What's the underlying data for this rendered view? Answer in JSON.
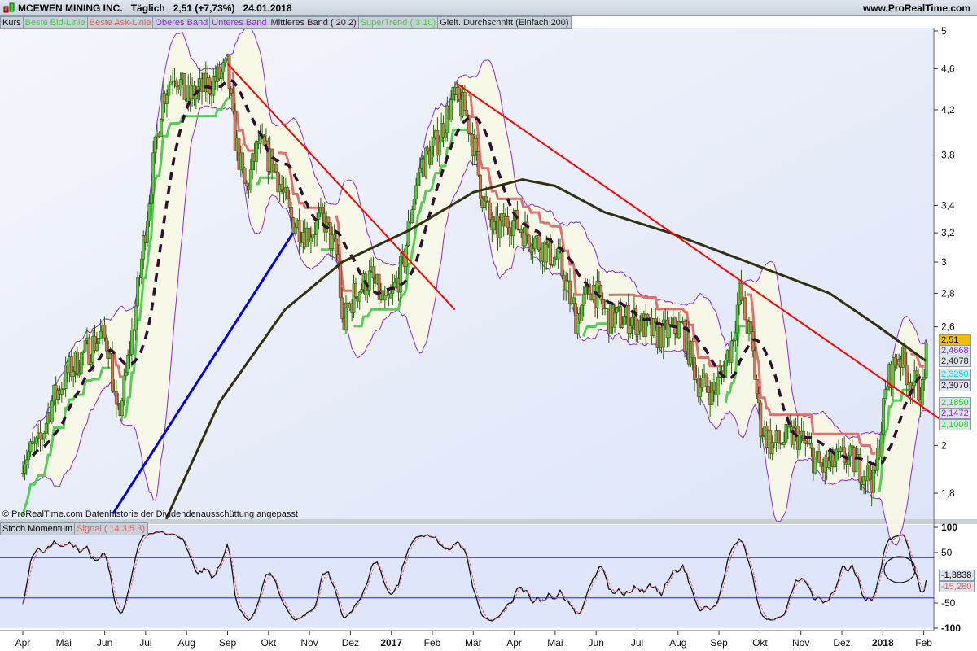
{
  "header": {
    "title": "MCEWEN MINING INC.",
    "period": "Täglich",
    "price": "2,51 (+7,73%)",
    "date": "24.01.2018",
    "url": "www.ProRealTime.com"
  },
  "legend": [
    "Kurs",
    "Beste Bid-Linie",
    "Beste Ask-Linie",
    "Oberes Band",
    "Unteres Band",
    "Mittleres Band ( 20 2)",
    "SuperTrend ( 3 10)",
    "Gleit. Durchschnitt (Einfach 200)"
  ],
  "legend_colors": [
    "#111111",
    "#44cc44",
    "#e06060",
    "#8a2be2",
    "#8a2be2",
    "#301030",
    "#44cc44",
    "#222222"
  ],
  "copyright": "© ProRealTime.com  Datenhistorie der Dividendenausschüttung angepasst",
  "lower_legend": [
    "Stoch Momentum",
    "Signal ( 14 3 5 3)"
  ],
  "value_boxes": [
    {
      "v": "2,51",
      "c": "#f0c000",
      "fg": "#000"
    },
    {
      "v": "2,4668",
      "c": "#dde4ea",
      "fg": "#8a2be2"
    },
    {
      "v": "2,4078",
      "c": "#dde4ea",
      "fg": "#222"
    },
    {
      "v": "2,3250",
      "c": "#dde4ea",
      "fg": "#00e0f0"
    },
    {
      "v": "2,3070",
      "c": "#dde4ea",
      "fg": "#301030"
    },
    {
      "v": "2,1850",
      "c": "#dde4ea",
      "fg": "#22cc22"
    },
    {
      "v": "2,1472",
      "c": "#dde4ea",
      "fg": "#8a2be2"
    },
    {
      "v": "2,1008",
      "c": "#dde4ea",
      "fg": "#44cc44"
    }
  ],
  "lower_boxes": [
    {
      "v": "-1,3838",
      "fg": "#000"
    },
    {
      "v": "-15,280",
      "fg": "#e06060"
    }
  ],
  "chart_data": {
    "type": "candlestick",
    "yscale": "log",
    "ylim": [
      1.65,
      5.05
    ],
    "yticks": [
      5,
      4.6,
      4.2,
      3.8,
      3.4,
      3.2,
      3,
      2.8,
      2.6,
      2,
      1.8
    ],
    "ytick_labels": [
      "5",
      "4,6",
      "4,2",
      "3,8",
      "3,4",
      "3,2",
      "3",
      "2,8",
      "2,6",
      "2",
      "1,8"
    ],
    "xticks": [
      "Apr",
      "Mai",
      "Jun",
      "Jul",
      "Aug",
      "Sep",
      "Okt",
      "Nov",
      "Dez",
      "2017",
      "Feb",
      "Mär",
      "Apr",
      "Mai",
      "Jun",
      "Jul",
      "Aug",
      "Sep",
      "Okt",
      "Nov",
      "Dez",
      "2018",
      "Feb"
    ],
    "price_path_month_index": [
      [
        0,
        1.95
      ],
      [
        0.4,
        2.0
      ],
      [
        0.7,
        2.2
      ],
      [
        1.1,
        2.35
      ],
      [
        1.5,
        2.45
      ],
      [
        1.9,
        2.55
      ],
      [
        2.1,
        2.5
      ],
      [
        2.3,
        2.1
      ],
      [
        2.5,
        2.3
      ],
      [
        2.8,
        2.8
      ],
      [
        3.1,
        3.5
      ],
      [
        3.4,
        4.3
      ],
      [
        3.7,
        4.6
      ],
      [
        4.0,
        4.3
      ],
      [
        4.4,
        4.4
      ],
      [
        4.75,
        4.5
      ],
      [
        5.0,
        4.6
      ],
      [
        5.15,
        4.0
      ],
      [
        5.45,
        3.5
      ],
      [
        5.75,
        3.9
      ],
      [
        6.15,
        3.7
      ],
      [
        6.55,
        3.3
      ],
      [
        6.95,
        3.2
      ],
      [
        7.35,
        3.3
      ],
      [
        7.7,
        3.0
      ],
      [
        7.8,
        2.6
      ],
      [
        8.1,
        2.8
      ],
      [
        8.5,
        2.9
      ],
      [
        8.9,
        2.7
      ],
      [
        9.3,
        3.0
      ],
      [
        9.5,
        3.4
      ],
      [
        9.7,
        3.7
      ],
      [
        10.1,
        3.9
      ],
      [
        10.5,
        4.3
      ],
      [
        10.8,
        4.2
      ],
      [
        11.0,
        3.9
      ],
      [
        11.2,
        3.5
      ],
      [
        11.5,
        3.2
      ],
      [
        11.9,
        3.3
      ],
      [
        12.3,
        3.2
      ],
      [
        12.7,
        3.1
      ],
      [
        13.1,
        3.0
      ],
      [
        13.5,
        2.65
      ],
      [
        13.9,
        2.85
      ],
      [
        14.3,
        2.65
      ],
      [
        14.9,
        2.65
      ],
      [
        15.5,
        2.55
      ],
      [
        16.1,
        2.6
      ],
      [
        16.5,
        2.3
      ],
      [
        16.9,
        2.25
      ],
      [
        17.3,
        2.5
      ],
      [
        17.5,
        2.8
      ],
      [
        17.8,
        2.5
      ],
      [
        18.0,
        2.1
      ],
      [
        18.3,
        2.0
      ],
      [
        18.9,
        2.05
      ],
      [
        19.5,
        1.9
      ],
      [
        20.1,
        1.95
      ],
      [
        20.5,
        1.9
      ],
      [
        20.8,
        1.85
      ],
      [
        21.1,
        2.3
      ],
      [
        21.4,
        2.45
      ],
      [
        21.7,
        2.3
      ],
      [
        22.0,
        2.25
      ],
      [
        22.06,
        2.51
      ]
    ],
    "sma200_month_index": [
      [
        3.5,
        1.7
      ],
      [
        4.8,
        2.2
      ],
      [
        6.4,
        2.7
      ],
      [
        7.8,
        3.0
      ],
      [
        9.45,
        3.22
      ],
      [
        11.0,
        3.5
      ],
      [
        12.2,
        3.6
      ],
      [
        13.0,
        3.55
      ],
      [
        14.2,
        3.35
      ],
      [
        15.8,
        3.2
      ],
      [
        17.7,
        3.0
      ],
      [
        19.7,
        2.8
      ],
      [
        20.9,
        2.6
      ],
      [
        22.06,
        2.41
      ]
    ],
    "trendlines": [
      {
        "color": "#ff0000",
        "from": [
          5.0,
          4.65
        ],
        "to": [
          10.55,
          2.7
        ]
      },
      {
        "color": "#ff0000",
        "from": [
          10.6,
          4.45
        ],
        "to": [
          22.4,
          2.12
        ]
      },
      {
        "color": "#0000ee",
        "from": [
          2.2,
          1.72
        ],
        "to": [
          6.6,
          3.2
        ]
      }
    ],
    "lower": {
      "title": "Stoch Momentum",
      "ylim": [
        -100,
        100
      ],
      "yticks": [
        100,
        50,
        -50,
        -100
      ],
      "hlines": [
        40,
        -40
      ]
    }
  }
}
